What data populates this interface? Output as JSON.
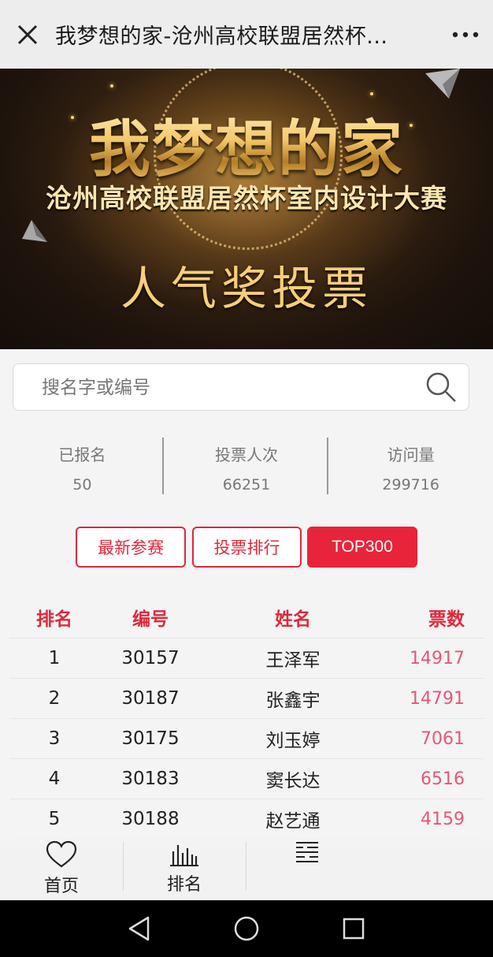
{
  "topbar": {
    "title": "我梦想的家-沧州高校联盟居然杯..."
  },
  "banner": {
    "title": "我梦想的家",
    "subtitle": "沧州高校联盟居然杯室内设计大赛",
    "vote_title": "人气奖投票"
  },
  "search": {
    "placeholder": "搜名字或编号"
  },
  "stats": [
    {
      "label": "已报名",
      "value": "50"
    },
    {
      "label": "投票人次",
      "value": "66251"
    },
    {
      "label": "访问量",
      "value": "299716"
    }
  ],
  "tabs": {
    "latest": "最新参赛",
    "ranking": "投票排行",
    "top": "TOP300"
  },
  "table": {
    "headers": {
      "rank": "排名",
      "number": "编号",
      "name": "姓名",
      "votes": "票数"
    },
    "rows": [
      {
        "rank": "1",
        "number": "30157",
        "name": "王泽军",
        "votes": "14917"
      },
      {
        "rank": "2",
        "number": "30187",
        "name": "张鑫宇",
        "votes": "14791"
      },
      {
        "rank": "3",
        "number": "30175",
        "name": "刘玉婷",
        "votes": "7061"
      },
      {
        "rank": "4",
        "number": "30183",
        "name": "窦长达",
        "votes": "6516"
      },
      {
        "rank": "5",
        "number": "30188",
        "name": "赵艺通",
        "votes": "4159"
      }
    ]
  },
  "bottomnav": {
    "home": "首页",
    "rank": "排名"
  },
  "colors": {
    "accent": "#e8243a",
    "votes": "#e7577a",
    "banner_gold": "#f6cf78"
  }
}
